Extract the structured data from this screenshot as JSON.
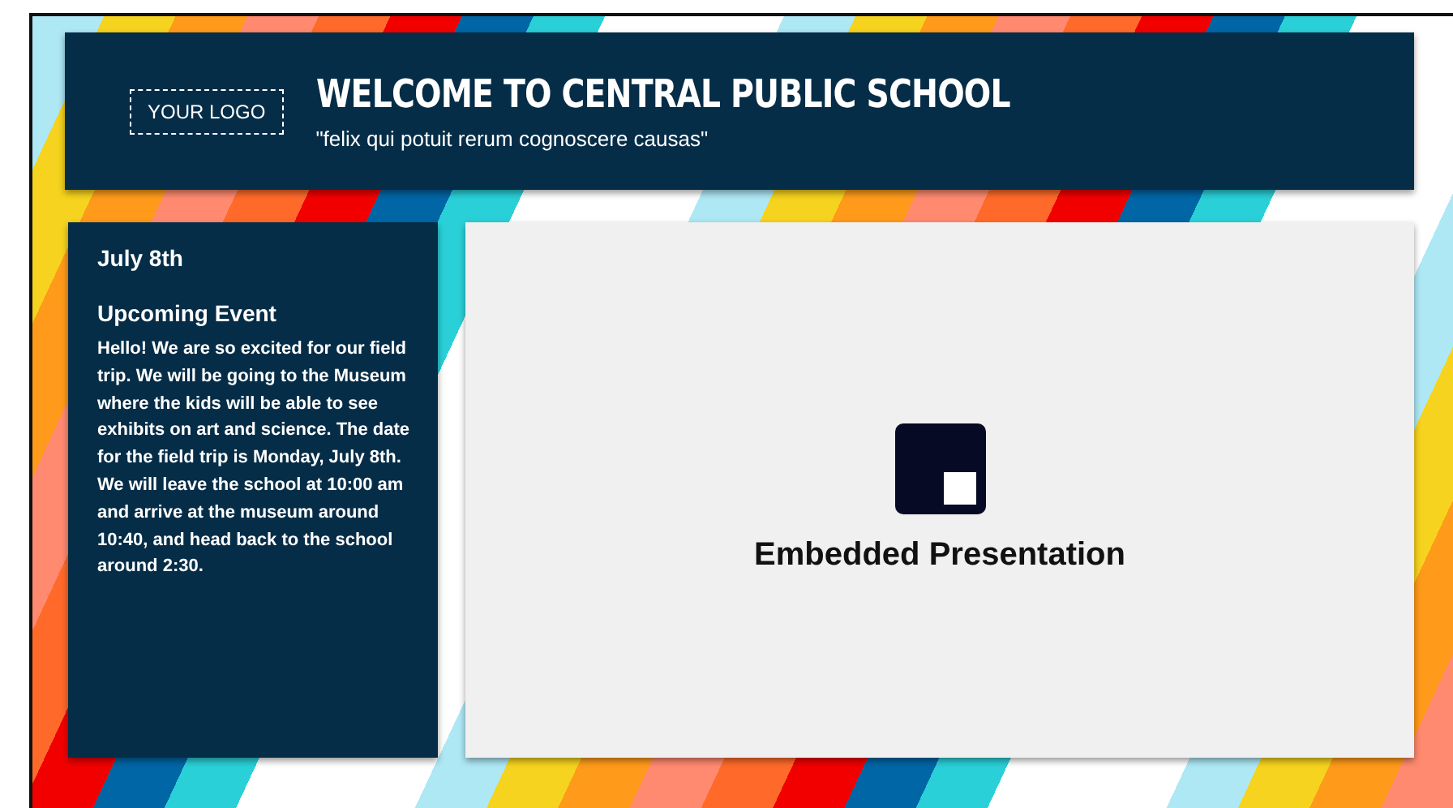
{
  "header": {
    "logo": "YOUR LOGO",
    "title": "WELCOME TO CENTRAL PUBLIC SCHOOL",
    "motto": "\"felix qui potuit rerum cognoscere causas\""
  },
  "sidebar": {
    "date": "July 8th",
    "heading": "Upcoming Event",
    "body": "Hello! We are so excited for our field trip. We will be going to the Museum where the kids will be able to see exhibits on art and science. The date for the field trip is Monday, July 8th. We will leave the school at 10:00 am and arrive at the museum around 10:40, and head back to the school around 2:30."
  },
  "main": {
    "label": "Embedded Presentation"
  }
}
